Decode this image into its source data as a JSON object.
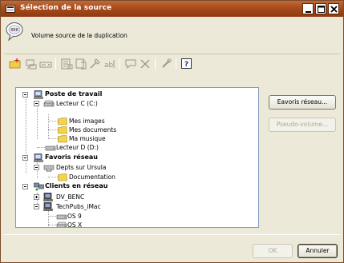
{
  "window": {
    "title": "Sélection de la source",
    "controls": [
      "minimize",
      "maximize",
      "close"
    ]
  },
  "header": {
    "text": "Volume source de la duplication",
    "icon": "speech-bubble-icon"
  },
  "toolbar": {
    "tools": [
      {
        "name": "new-folder-icon",
        "enabled": true
      },
      {
        "name": "network-favorite-icon",
        "enabled": false
      },
      {
        "name": "drive-icon",
        "enabled": false
      },
      {
        "name": "properties-icon",
        "enabled": false
      },
      {
        "name": "share-icon",
        "enabled": false
      },
      {
        "name": "explore-icon",
        "enabled": false
      },
      {
        "name": "rename-icon",
        "enabled": false
      },
      {
        "name": "comment-icon",
        "enabled": false
      },
      {
        "name": "delete-icon",
        "enabled": false
      },
      {
        "name": "refresh-icon",
        "enabled": false
      },
      {
        "name": "help-icon",
        "enabled": true
      }
    ]
  },
  "tree": {
    "poste": {
      "label": "Poste de travail"
    },
    "lecteur_c": {
      "label": "Lecteur C (C:)"
    },
    "mes_images": {
      "label": "Mes images"
    },
    "mes_documents": {
      "label": "Mes documents"
    },
    "ma_musique": {
      "label": "Ma musique"
    },
    "lecteur_d": {
      "label": "Lecteur D (D:)"
    },
    "favoris": {
      "label": "Favoris réseau"
    },
    "depts": {
      "label": "Depts sur Ursula"
    },
    "documentation": {
      "label": "Documentation"
    },
    "clients": {
      "label": "Clients en réseau"
    },
    "dv_benc": {
      "label": "DV_BENC"
    },
    "techpubs": {
      "label": "TechPubs_iMac"
    },
    "os9": {
      "label": "OS 9"
    },
    "osx": {
      "label": "OS X"
    }
  },
  "buttons": {
    "favoris_reseau": "Eavoris réseau...",
    "pseudo_volume": "Pseudo-volume...",
    "ok": "OK",
    "annuler": "Annuler"
  }
}
